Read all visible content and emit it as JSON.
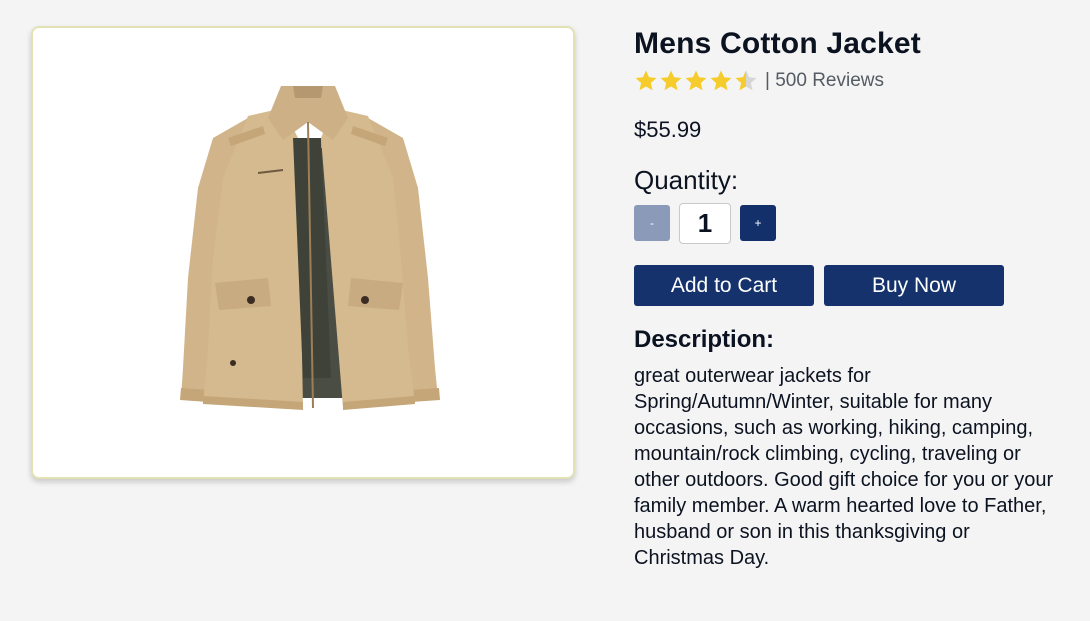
{
  "product": {
    "title": "Mens Cotton Jacket",
    "rating": 4.5,
    "rating_max": 5,
    "reviews_text": "| 500 Reviews",
    "price": "$55.99",
    "image_alt": "Khaki cotton jacket product image"
  },
  "quantity": {
    "label": "Quantity:",
    "value": "1",
    "minus_label": "-",
    "plus_label": "+"
  },
  "actions": {
    "add_to_cart": "Add to Cart",
    "buy_now": "Buy Now"
  },
  "description": {
    "heading": "Description:",
    "text": "great outerwear jackets for Spring/Autumn/Winter, suitable for many occasions, such as working, hiking, camping, mountain/rock climbing, cycling, traveling or other outdoors. Good gift choice for you or your family member. A warm hearted love to Father, husband or son in this thanksgiving or Christmas Day."
  },
  "colors": {
    "page_bg": "#f4f4f4",
    "primary": "#15326c",
    "minus_button": "#8a9ab8",
    "star": "#f5cc2b",
    "star_empty": "#d6d6d6",
    "card_border": "#e3e2b4"
  }
}
